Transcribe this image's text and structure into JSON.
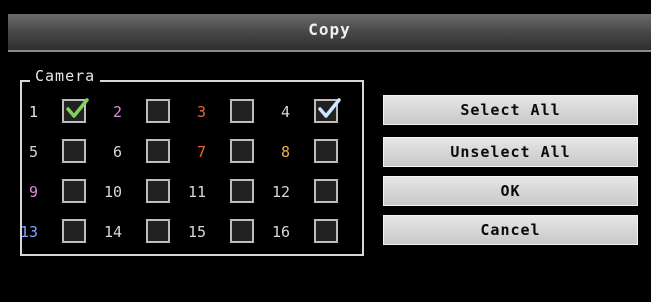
{
  "dialog": {
    "title": "Copy",
    "group_label": "Camera"
  },
  "cameras": [
    {
      "label": "1",
      "checked": true,
      "color": "#e6e6e6"
    },
    {
      "label": "2",
      "checked": false,
      "color": "#d98fd9"
    },
    {
      "label": "3",
      "checked": false,
      "color": "#e8653a"
    },
    {
      "label": "4",
      "checked": true,
      "color": "#d8d8d8"
    },
    {
      "label": "5",
      "checked": false,
      "color": "#d8d8d8"
    },
    {
      "label": "6",
      "checked": false,
      "color": "#d8d8d8"
    },
    {
      "label": "7",
      "checked": false,
      "color": "#e8653a"
    },
    {
      "label": "8",
      "checked": false,
      "color": "#e8b04a"
    },
    {
      "label": "9",
      "checked": false,
      "color": "#d98fd9"
    },
    {
      "label": "10",
      "checked": false,
      "color": "#d8d8d8"
    },
    {
      "label": "11",
      "checked": false,
      "color": "#d8d8d8"
    },
    {
      "label": "12",
      "checked": false,
      "color": "#d8d8d8"
    },
    {
      "label": "13",
      "checked": false,
      "color": "#7aa6ff"
    },
    {
      "label": "14",
      "checked": false,
      "color": "#d8d8d8"
    },
    {
      "label": "15",
      "checked": false,
      "color": "#d8d8d8"
    },
    {
      "label": "16",
      "checked": false,
      "color": "#d8d8d8"
    }
  ],
  "buttons": {
    "select_all": "Select All",
    "unselect_all": "Unselect All",
    "ok": "OK",
    "cancel": "Cancel"
  },
  "colors": {
    "checked_tick": "#cfe8ff",
    "checked_tick_first": "#7fd25a",
    "box_border": "#bdbdbd",
    "dialog_background": "#000000"
  }
}
